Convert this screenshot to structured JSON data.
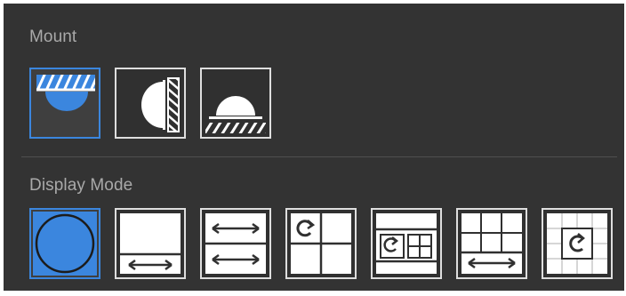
{
  "mount": {
    "title": "Mount",
    "options": [
      {
        "icon": "ceiling-mount-icon",
        "selected": true
      },
      {
        "icon": "wall-mount-icon",
        "selected": false
      },
      {
        "icon": "floor-mount-icon",
        "selected": false
      }
    ]
  },
  "display_mode": {
    "title": "Display Mode",
    "options": [
      {
        "icon": "fisheye-view-icon",
        "selected": true
      },
      {
        "icon": "panorama-view-icon",
        "selected": false
      },
      {
        "icon": "double-panorama-view-icon",
        "selected": false
      },
      {
        "icon": "quad-view-icon",
        "selected": false
      },
      {
        "icon": "fisheye-plus-views-icon",
        "selected": false
      },
      {
        "icon": "panorama-plus-views-icon",
        "selected": false
      },
      {
        "icon": "fisheye-plus-multi-views-icon",
        "selected": false
      }
    ]
  },
  "colors": {
    "panel_bg": "#333333",
    "accent": "#3b86de",
    "icon_fill": "#ffffff",
    "label": "#a9a9a9"
  }
}
